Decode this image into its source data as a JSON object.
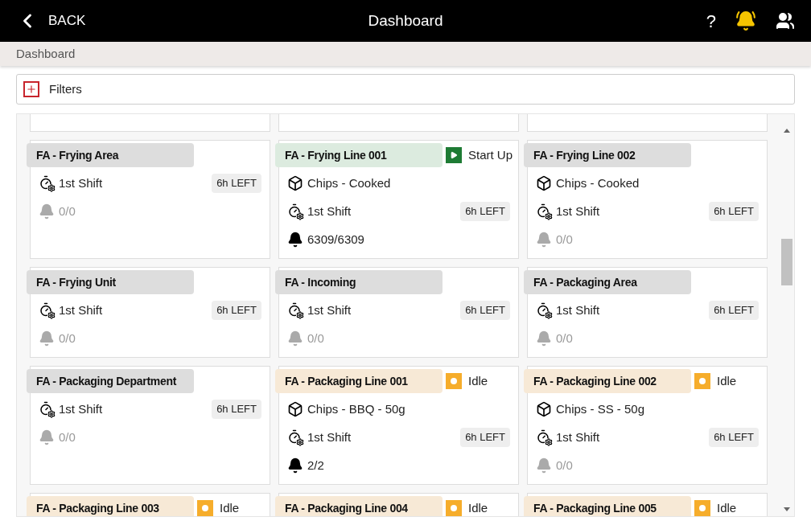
{
  "header": {
    "back_label": "BACK",
    "title": "Dashboard",
    "help": "?"
  },
  "breadcrumb": "Dashboard",
  "filters": {
    "label": "Filters",
    "expanded": false
  },
  "cards": [
    {
      "title": "FA - Frying Area",
      "shift": "1st Shift",
      "time_left": "6h LEFT",
      "alarms": "0/0",
      "alarm_active": false
    },
    {
      "title": "FA - Frying Line 001",
      "status": {
        "kind": "running",
        "label": "Start Up"
      },
      "product": "Chips - Cooked",
      "shift": "1st Shift",
      "time_left": "6h LEFT",
      "alarms": "6309/6309",
      "alarm_active": true
    },
    {
      "title": "FA - Frying Line 002",
      "product": "Chips - Cooked",
      "shift": "1st Shift",
      "time_left": "6h LEFT",
      "alarms": "0/0",
      "alarm_active": false
    },
    {
      "title": "FA - Frying Unit",
      "shift": "1st Shift",
      "time_left": "6h LEFT",
      "alarms": "0/0",
      "alarm_active": false
    },
    {
      "title": "FA - Incoming",
      "shift": "1st Shift",
      "time_left": "6h LEFT",
      "alarms": "0/0",
      "alarm_active": false
    },
    {
      "title": "FA - Packaging Area",
      "shift": "1st Shift",
      "time_left": "6h LEFT",
      "alarms": "0/0",
      "alarm_active": false
    },
    {
      "title": "FA - Packaging Department",
      "shift": "1st Shift",
      "time_left": "6h LEFT",
      "alarms": "0/0",
      "alarm_active": false
    },
    {
      "title": "FA - Packaging Line 001",
      "status": {
        "kind": "idle",
        "label": "Idle"
      },
      "product": "Chips - BBQ - 50g",
      "shift": "1st Shift",
      "time_left": "6h LEFT",
      "alarms": "2/2",
      "alarm_active": true
    },
    {
      "title": "FA - Packaging Line 002",
      "status": {
        "kind": "idle",
        "label": "Idle"
      },
      "product": "Chips - SS - 50g",
      "shift": "1st Shift",
      "time_left": "6h LEFT",
      "alarms": "0/0",
      "alarm_active": false
    },
    {
      "title": "FA - Packaging Line 003",
      "status": {
        "kind": "idle",
        "label": "Idle"
      }
    },
    {
      "title": "FA - Packaging Line 004",
      "status": {
        "kind": "idle",
        "label": "Idle"
      }
    },
    {
      "title": "FA - Packaging Line 005",
      "status": {
        "kind": "idle",
        "label": "Idle"
      }
    }
  ]
}
